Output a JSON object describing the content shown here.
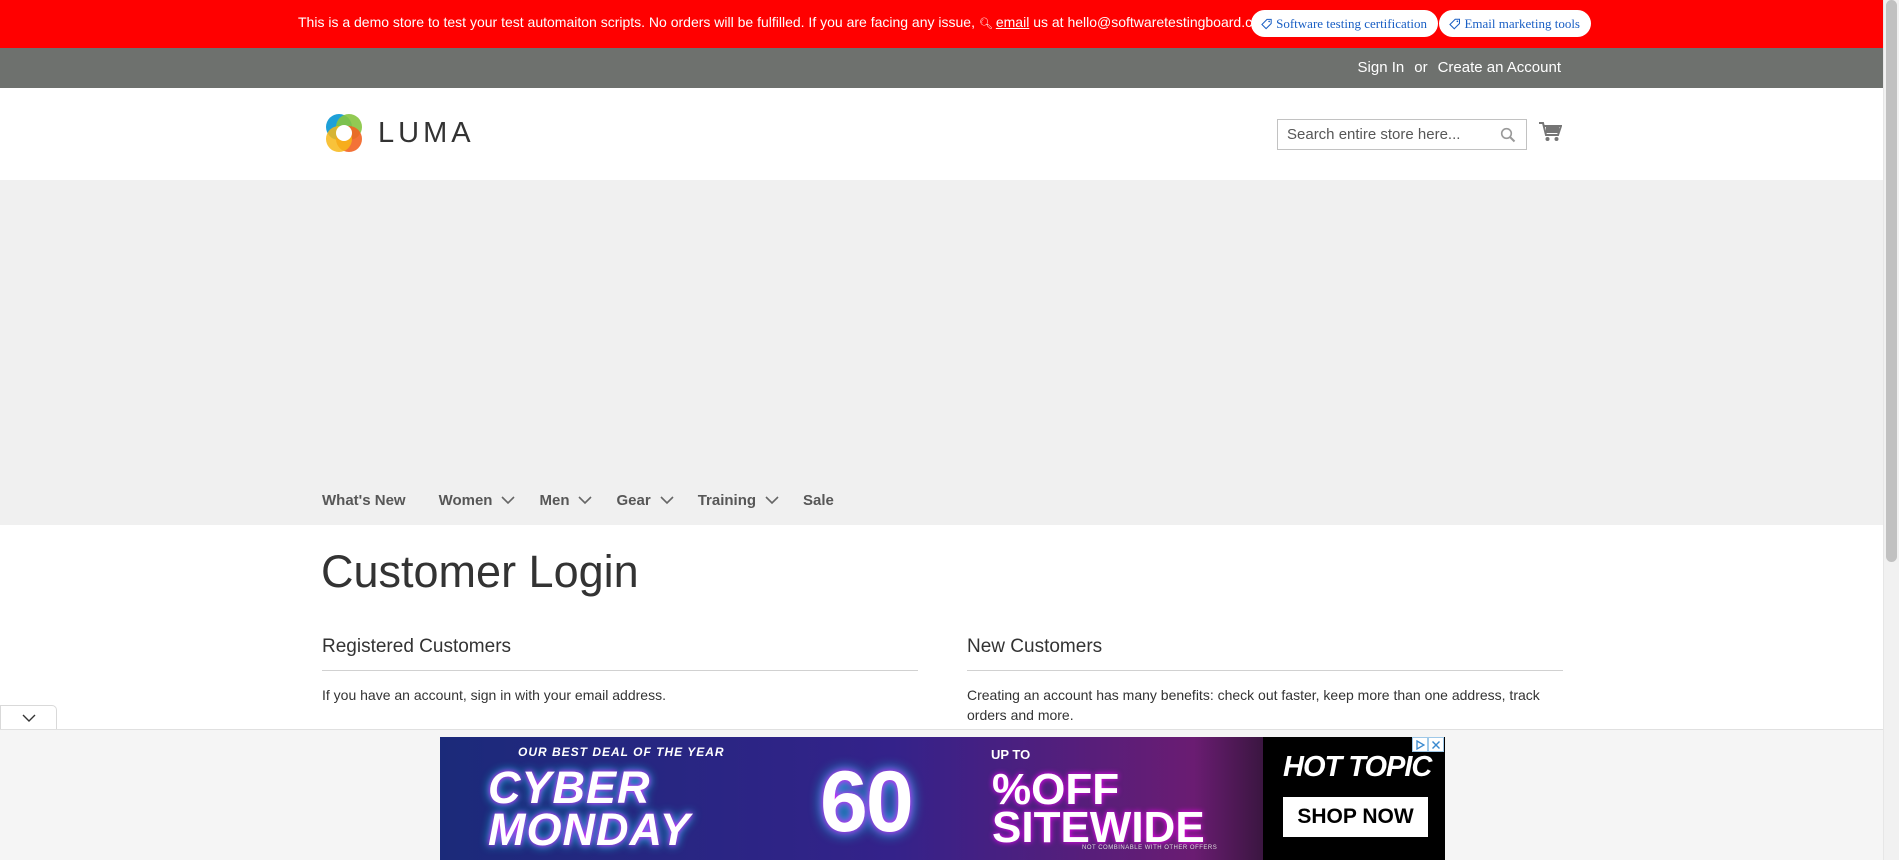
{
  "notice": {
    "text_before": "This is a demo store to test your test automaiton scripts. No orders will be fulfilled. If you are facing any issue,",
    "key_icon": "key-icon",
    "email_link": "email",
    "text_after": "us at hello@softwaretestingboard.com.",
    "pill1": "Software testing certification",
    "pill2": "Email marketing tools"
  },
  "account": {
    "sign_in": "Sign In",
    "or": "or",
    "create": "Create an Account"
  },
  "header": {
    "logo_text": "LUMA",
    "search_placeholder": "Search entire store here...",
    "search_value": "",
    "search_icon": "search-icon",
    "cart_icon": "cart-icon"
  },
  "nav": {
    "items": [
      {
        "label": "What's New"
      },
      {
        "label": "Women"
      },
      {
        "label": "Men"
      },
      {
        "label": "Gear"
      },
      {
        "label": "Training"
      },
      {
        "label": "Sale"
      }
    ]
  },
  "main": {
    "title": "Customer Login",
    "registered": {
      "heading": "Registered Customers",
      "text": "If you have an account, sign in with your email address."
    },
    "new_customers": {
      "heading": "New Customers",
      "text": "Creating an account has many benefits: check out faster, keep more than one address, track orders and more."
    }
  },
  "ad": {
    "promo_small": "OUR BEST DEAL OF THE YEAR",
    "headline_line1": "CYBER",
    "headline_line2": "MONDAY",
    "up_to": "UP TO",
    "big": "60",
    "offer_line1": "%OFF",
    "offer_line2": "SITEWIDE",
    "fine_print": "NOT COMBINABLE WITH OTHER OFFERS",
    "brand": "HOT TOPIC",
    "cta": "SHOP NOW"
  },
  "colors": {
    "notice_bg": "#ff0000",
    "account_bg": "#6e716e",
    "banner_bg": "#f0f0f0",
    "pill_text": "#1a5fc4"
  }
}
